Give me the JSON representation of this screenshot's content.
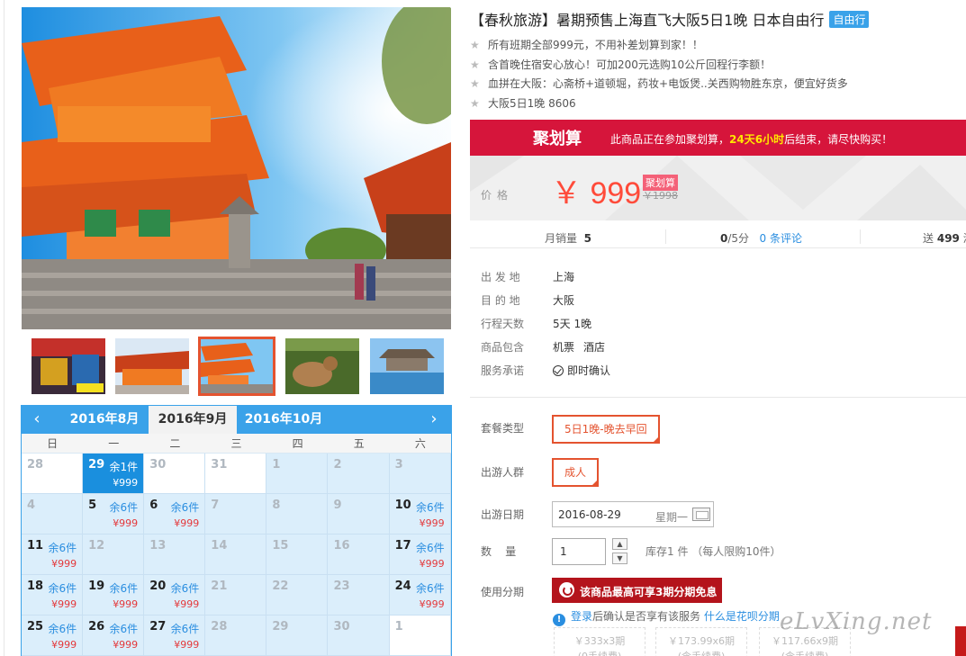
{
  "product": {
    "title": "【春秋旅游】暑期预售上海直飞大阪5日1晚 日本自由行",
    "tag": "自由行",
    "features": [
      "所有班期全部999元，不用补差划算到家！！",
      "含首晚住宿安心放心！可加200元选购10公斤回程行李额！",
      "血拼在大阪：心斋桥+道顿堀，药妆+电饭煲..关西购物胜东京，便宜好货多",
      "大阪5日1晚 8606"
    ]
  },
  "promo": {
    "logo": "聚划算",
    "msg_before": "此商品正在参加聚划算，",
    "msg_highlight": "24天6小时",
    "msg_after": "后结束，请尽快购买！"
  },
  "price": {
    "label": "价格",
    "current": "￥ 999",
    "tag": "聚划算",
    "original": "￥1998"
  },
  "stats": {
    "monthly_sales_label": "月销量",
    "monthly_sales_value": "5",
    "rating_value": "0",
    "rating_suffix": "/5分",
    "reviews_link": "0 条评论",
    "points_label": "送",
    "points_value": "499",
    "points_suffix": "淘"
  },
  "details": [
    {
      "key": "出 发 地",
      "value": "上海"
    },
    {
      "key": "目 的 地",
      "value": "大阪"
    },
    {
      "key": "行程天数",
      "value": "5天 1晚"
    },
    {
      "key": "商品包含",
      "value": "机票",
      "value2": "酒店"
    },
    {
      "key": "服务承诺",
      "value": "即时确认"
    }
  ],
  "options": {
    "package_label": "套餐类型",
    "package_value": "5日1晚-晚去早回",
    "traveler_label": "出游人群",
    "traveler_value": "成人",
    "date_label": "出游日期",
    "date_value": "2016-08-29",
    "date_weekday": "星期一",
    "quantity_label": "数    量",
    "quantity_value": "1",
    "stock_note": "库存1 件  （每人限购10件）",
    "installment_label": "使用分期",
    "installment_button": "该商品最高可享3期分期免息",
    "login_link": "登录",
    "login_text": "后确认是否享有该服务",
    "huabei_link": "什么是花呗分期",
    "plans": [
      {
        "line1": "￥333x3期",
        "line2": "(0手续费)"
      },
      {
        "line1": "￥173.99x6期",
        "line2": "(含手续费)"
      },
      {
        "line1": "￥117.66x9期",
        "line2": "(含手续费)"
      }
    ]
  },
  "calendar": {
    "prev_month": "2016年8月",
    "current_month": "2016年9月",
    "next_month": "2016年10月",
    "weekdays": [
      "日",
      "一",
      "二",
      "三",
      "四",
      "五",
      "六"
    ],
    "days": [
      {
        "d": "28",
        "style": "white"
      },
      {
        "d": "29",
        "style": "sel",
        "stock": "余1件",
        "price": "¥999"
      },
      {
        "d": "30",
        "style": "white"
      },
      {
        "d": "31",
        "style": "white"
      },
      {
        "d": "1",
        "style": "blue"
      },
      {
        "d": "2",
        "style": "blue"
      },
      {
        "d": "3",
        "style": "blue"
      },
      {
        "d": "4",
        "style": "blue"
      },
      {
        "d": "5",
        "style": "blue",
        "stock": "余6件",
        "price": "¥999"
      },
      {
        "d": "6",
        "style": "blue",
        "stock": "余6件",
        "price": "¥999"
      },
      {
        "d": "7",
        "style": "blue"
      },
      {
        "d": "8",
        "style": "blue"
      },
      {
        "d": "9",
        "style": "blue"
      },
      {
        "d": "10",
        "style": "blue",
        "stock": "余6件",
        "price": "¥999"
      },
      {
        "d": "11",
        "style": "blue",
        "stock": "余6件",
        "price": "¥999"
      },
      {
        "d": "12",
        "style": "blue"
      },
      {
        "d": "13",
        "style": "blue"
      },
      {
        "d": "14",
        "style": "blue"
      },
      {
        "d": "15",
        "style": "blue"
      },
      {
        "d": "16",
        "style": "blue"
      },
      {
        "d": "17",
        "style": "blue",
        "stock": "余6件",
        "price": "¥999"
      },
      {
        "d": "18",
        "style": "blue",
        "stock": "余6件",
        "price": "¥999"
      },
      {
        "d": "19",
        "style": "blue",
        "stock": "余6件",
        "price": "¥999"
      },
      {
        "d": "20",
        "style": "blue",
        "stock": "余6件",
        "price": "¥999"
      },
      {
        "d": "21",
        "style": "blue"
      },
      {
        "d": "22",
        "style": "blue"
      },
      {
        "d": "23",
        "style": "blue"
      },
      {
        "d": "24",
        "style": "blue",
        "stock": "余6件",
        "price": "¥999"
      },
      {
        "d": "25",
        "style": "blue",
        "stock": "余6件",
        "price": "¥999"
      },
      {
        "d": "26",
        "style": "blue",
        "stock": "余6件",
        "price": "¥999"
      },
      {
        "d": "27",
        "style": "blue",
        "stock": "余6件",
        "price": "¥999"
      },
      {
        "d": "28",
        "style": "blue"
      },
      {
        "d": "29",
        "style": "blue"
      },
      {
        "d": "30",
        "style": "blue"
      },
      {
        "d": "1",
        "style": "white"
      }
    ]
  },
  "watermark": "eLvXing.net",
  "colors": {
    "accent_blue": "#3aa2e9",
    "promo_red": "#d6153b",
    "price_red": "#ff4b3a",
    "option_orange": "#e4532f",
    "installment_red": "#b4141c"
  }
}
